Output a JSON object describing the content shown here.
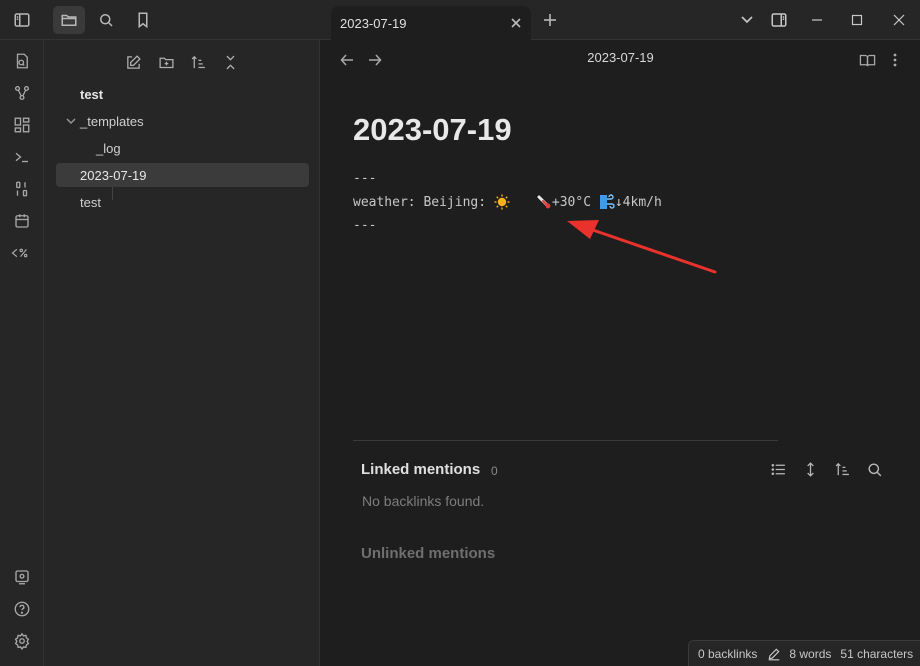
{
  "tab": {
    "title": "2023-07-19"
  },
  "explorer": {
    "items": [
      {
        "label": "test"
      },
      {
        "label": "_templates"
      },
      {
        "label": "_log"
      },
      {
        "label": "2023-07-19"
      },
      {
        "label": "test"
      }
    ]
  },
  "main": {
    "view_title": "2023-07-19",
    "doc_title": "2023-07-19",
    "frontmatter_open": "---",
    "weather_label": "weather: Beijing: ",
    "weather_temp": "+30°C ",
    "weather_wind": "↓4km/h",
    "frontmatter_close": "---"
  },
  "backlinks": {
    "linked_title": "Linked mentions",
    "linked_count": "0",
    "empty_text": "No backlinks found.",
    "unlinked_title": "Unlinked mentions"
  },
  "status": {
    "backlinks": "0 backlinks",
    "words": "8 words",
    "characters": "51 characters"
  },
  "colors": {
    "accent_arrow": "#e8322b",
    "background": "#1e1e1e",
    "sidebar": "#262626"
  }
}
